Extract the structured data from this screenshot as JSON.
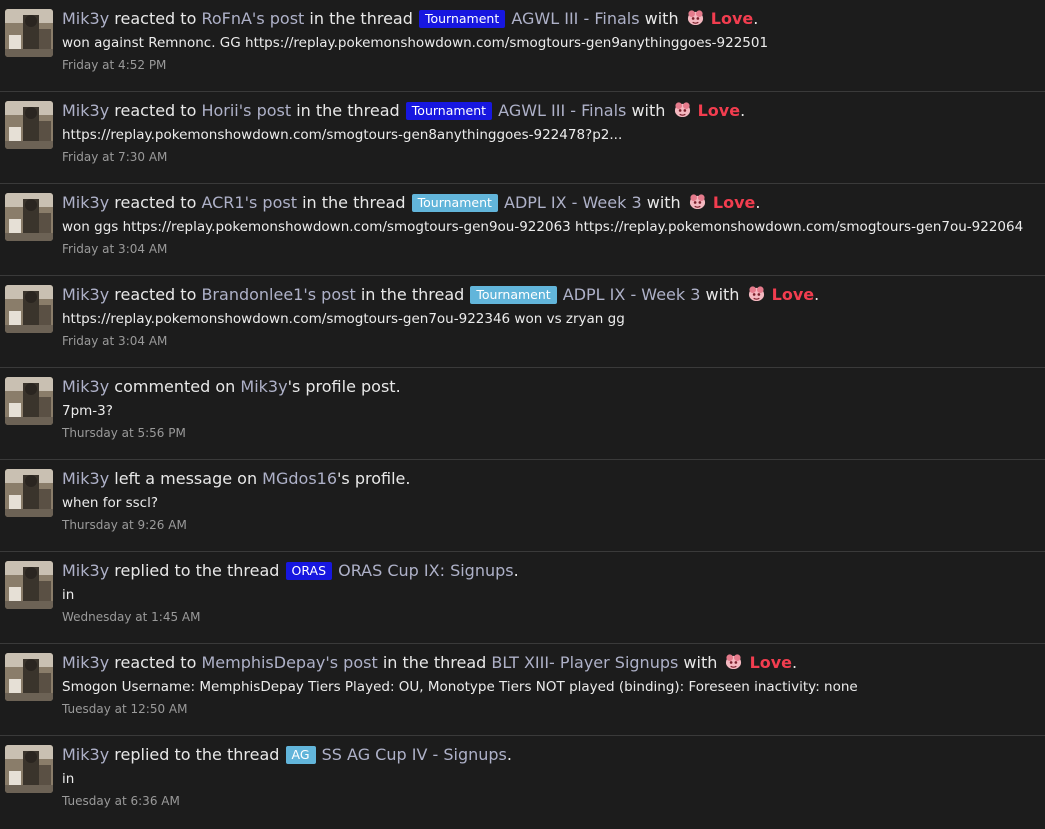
{
  "colors": {
    "label_blue": "#1717e0",
    "label_lightblue": "#62b5da",
    "love_red": "#f23d4f",
    "link": "#aeb1c8",
    "background": "#1c1c1c"
  },
  "reaction_name": "Love",
  "items": [
    {
      "actor": "Mik3y",
      "verb": "reacted to",
      "target": "RoFnA's post",
      "mid": "in the thread",
      "prefix": "Tournament",
      "prefix_color": "#1717e0",
      "thread": "AGWL III - Finals",
      "tail": "with",
      "snippet": "won against Remnonc. GG https://replay.pokemonshowdown.com/smogtours-gen9anythinggoes-922501",
      "time": "Friday at 4:52 PM"
    },
    {
      "actor": "Mik3y",
      "verb": "reacted to",
      "target": "Horii's post",
      "mid": "in the thread",
      "prefix": "Tournament",
      "prefix_color": "#1717e0",
      "thread": "AGWL III - Finals",
      "tail": "with",
      "snippet": "https://replay.pokemonshowdown.com/smogtours-gen8anythinggoes-922478?p2...",
      "time": "Friday at 7:30 AM"
    },
    {
      "actor": "Mik3y",
      "verb": "reacted to",
      "target": "ACR1's post",
      "mid": "in the thread",
      "prefix": "Tournament",
      "prefix_color": "#62b5da",
      "thread": "ADPL IX - Week 3",
      "tail": "with",
      "snippet": "won ggs https://replay.pokemonshowdown.com/smogtours-gen9ou-922063 https://replay.pokemonshowdown.com/smogtours-gen7ou-922064",
      "time": "Friday at 3:04 AM"
    },
    {
      "actor": "Mik3y",
      "verb": "reacted to",
      "target": "Brandonlee1's post",
      "mid": "in the thread",
      "prefix": "Tournament",
      "prefix_color": "#62b5da",
      "thread": "ADPL IX - Week 3",
      "tail": "with",
      "snippet": "https://replay.pokemonshowdown.com/smogtours-gen7ou-922346 won vs zryan gg",
      "time": "Friday at 3:04 AM"
    },
    {
      "actor": "Mik3y",
      "verb": "commented on",
      "target": "Mik3y",
      "mid": "'s profile post.",
      "prefix": "",
      "prefix_color": "",
      "thread": "",
      "tail": "",
      "snippet": "7pm-3?",
      "time": "Thursday at 5:56 PM"
    },
    {
      "actor": "Mik3y",
      "verb": "left a message on",
      "target": "MGdos16",
      "mid": "'s profile.",
      "prefix": "",
      "prefix_color": "",
      "thread": "",
      "tail": "",
      "snippet": "when for sscl?",
      "time": "Thursday at 9:26 AM"
    },
    {
      "actor": "Mik3y",
      "verb": "replied to the thread",
      "target": "",
      "mid": "",
      "prefix": "ORAS",
      "prefix_color": "#1717e0",
      "thread": "ORAS Cup IX: Signups",
      "tail": ".",
      "snippet": "in",
      "time": "Wednesday at 1:45 AM"
    },
    {
      "actor": "Mik3y",
      "verb": "reacted to",
      "target": "MemphisDepay's post",
      "mid": "in the thread",
      "prefix": "",
      "prefix_color": "",
      "thread": "BLT XIII- Player Signups",
      "tail": "with",
      "snippet": "Smogon Username: MemphisDepay Tiers Played: OU, Monotype Tiers NOT played (binding): Foreseen inactivity: none",
      "time": "Tuesday at 12:50 AM"
    },
    {
      "actor": "Mik3y",
      "verb": "replied to the thread",
      "target": "",
      "mid": "",
      "prefix": "AG",
      "prefix_color": "#62b5da",
      "thread": "SS AG Cup IV - Signups",
      "tail": ".",
      "snippet": "in",
      "time": "Tuesday at 6:36 AM"
    }
  ]
}
